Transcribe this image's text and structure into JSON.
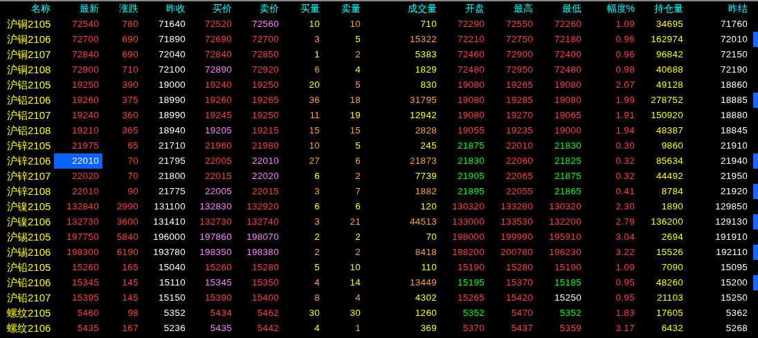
{
  "columns": [
    "名称",
    "最新",
    "涨跌",
    "昨收",
    "买价",
    "卖价",
    "买量",
    "卖量",
    "成交量",
    "开盘",
    "最高",
    "最低",
    "幅度%",
    "持仓量",
    "昨结"
  ],
  "rows": [
    {
      "name": "沪铜2105",
      "selected": false,
      "marked": false,
      "cells": [
        {
          "text": "72540",
          "color": "#ff4040"
        },
        {
          "text": "780",
          "color": "#ff4040"
        },
        {
          "text": "71640",
          "color": "#ffffff"
        },
        {
          "text": "72520",
          "color": "#ff4040"
        },
        {
          "text": "72560",
          "color": "#ff80ff"
        },
        {
          "text": "10",
          "color": "#ffff00"
        },
        {
          "text": "10",
          "color": "#ff9f40"
        },
        {
          "text": "710",
          "color": "#ffff00"
        },
        {
          "text": "72290",
          "color": "#ff4040"
        },
        {
          "text": "72550",
          "color": "#ff4040"
        },
        {
          "text": "72260",
          "color": "#ff4040"
        },
        {
          "text": "1.09",
          "color": "#ff4040"
        },
        {
          "text": "34695",
          "color": "#ffff00"
        },
        {
          "text": "71760",
          "color": "#ffffff"
        }
      ]
    },
    {
      "name": "沪铜2106",
      "selected": false,
      "marked": true,
      "cells": [
        {
          "text": "72700",
          "color": "#ff4040"
        },
        {
          "text": "690",
          "color": "#ff4040"
        },
        {
          "text": "71890",
          "color": "#ffffff"
        },
        {
          "text": "72690",
          "color": "#ff4040"
        },
        {
          "text": "72700",
          "color": "#ff4040"
        },
        {
          "text": "3",
          "color": "#ff9f40"
        },
        {
          "text": "5",
          "color": "#ffff00"
        },
        {
          "text": "15322",
          "color": "#ff9f40"
        },
        {
          "text": "72210",
          "color": "#ff4040"
        },
        {
          "text": "72750",
          "color": "#ff4040"
        },
        {
          "text": "72180",
          "color": "#ff4040"
        },
        {
          "text": "0.96",
          "color": "#ff4040"
        },
        {
          "text": "162974",
          "color": "#ffff00"
        },
        {
          "text": "72010",
          "color": "#ffffff"
        }
      ]
    },
    {
      "name": "沪铜2107",
      "selected": false,
      "marked": false,
      "cells": [
        {
          "text": "72840",
          "color": "#ff4040"
        },
        {
          "text": "690",
          "color": "#ff4040"
        },
        {
          "text": "72040",
          "color": "#ffffff"
        },
        {
          "text": "72840",
          "color": "#ff4040"
        },
        {
          "text": "72850",
          "color": "#ff4040"
        },
        {
          "text": "1",
          "color": "#ffff00"
        },
        {
          "text": "2",
          "color": "#ff9f40"
        },
        {
          "text": "5383",
          "color": "#ffff00"
        },
        {
          "text": "72460",
          "color": "#ff4040"
        },
        {
          "text": "72900",
          "color": "#ff4040"
        },
        {
          "text": "72400",
          "color": "#ff4040"
        },
        {
          "text": "0.96",
          "color": "#ff4040"
        },
        {
          "text": "96842",
          "color": "#ffff00"
        },
        {
          "text": "72150",
          "color": "#ffffff"
        }
      ]
    },
    {
      "name": "沪铜2108",
      "selected": false,
      "marked": false,
      "cells": [
        {
          "text": "72900",
          "color": "#ff4040"
        },
        {
          "text": "710",
          "color": "#ff4040"
        },
        {
          "text": "72100",
          "color": "#ffffff"
        },
        {
          "text": "72890",
          "color": "#ff80ff"
        },
        {
          "text": "72920",
          "color": "#ff4040"
        },
        {
          "text": "6",
          "color": "#ff9f40"
        },
        {
          "text": "4",
          "color": "#ffff00"
        },
        {
          "text": "1829",
          "color": "#ffff00"
        },
        {
          "text": "72480",
          "color": "#ff4040"
        },
        {
          "text": "72950",
          "color": "#ff4040"
        },
        {
          "text": "72480",
          "color": "#ff4040"
        },
        {
          "text": "0.98",
          "color": "#ff4040"
        },
        {
          "text": "40688",
          "color": "#ffff00"
        },
        {
          "text": "72190",
          "color": "#ffffff"
        }
      ]
    },
    {
      "name": "沪铝2105",
      "selected": false,
      "marked": false,
      "cells": [
        {
          "text": "19250",
          "color": "#ff4040"
        },
        {
          "text": "390",
          "color": "#ff4040"
        },
        {
          "text": "19000",
          "color": "#ffffff"
        },
        {
          "text": "19240",
          "color": "#ff4040"
        },
        {
          "text": "19250",
          "color": "#ff4040"
        },
        {
          "text": "20",
          "color": "#ffff00"
        },
        {
          "text": "5",
          "color": "#ff9f40"
        },
        {
          "text": "830",
          "color": "#ffff00"
        },
        {
          "text": "19080",
          "color": "#ff4040"
        },
        {
          "text": "19265",
          "color": "#ff4040"
        },
        {
          "text": "19080",
          "color": "#ff4040"
        },
        {
          "text": "2.07",
          "color": "#ff4040"
        },
        {
          "text": "49128",
          "color": "#ffff00"
        },
        {
          "text": "18860",
          "color": "#ffffff"
        }
      ]
    },
    {
      "name": "沪铝2106",
      "selected": false,
      "marked": true,
      "cells": [
        {
          "text": "19260",
          "color": "#ff4040"
        },
        {
          "text": "375",
          "color": "#ff4040"
        },
        {
          "text": "18990",
          "color": "#ffffff"
        },
        {
          "text": "19260",
          "color": "#ff4040"
        },
        {
          "text": "19265",
          "color": "#ff4040"
        },
        {
          "text": "36",
          "color": "#ff9f40"
        },
        {
          "text": "18",
          "color": "#ff9f40"
        },
        {
          "text": "31795",
          "color": "#ff9f40"
        },
        {
          "text": "19080",
          "color": "#ff4040"
        },
        {
          "text": "19285",
          "color": "#ff4040"
        },
        {
          "text": "19080",
          "color": "#ff4040"
        },
        {
          "text": "1.99",
          "color": "#ff4040"
        },
        {
          "text": "278752",
          "color": "#ffff00"
        },
        {
          "text": "18885",
          "color": "#ffffff"
        }
      ]
    },
    {
      "name": "沪铝2107",
      "selected": false,
      "marked": false,
      "cells": [
        {
          "text": "19240",
          "color": "#ff4040"
        },
        {
          "text": "360",
          "color": "#ff4040"
        },
        {
          "text": "18990",
          "color": "#ffffff"
        },
        {
          "text": "19245",
          "color": "#ff4040"
        },
        {
          "text": "19250",
          "color": "#ff4040"
        },
        {
          "text": "11",
          "color": "#ff9f40"
        },
        {
          "text": "19",
          "color": "#ffff00"
        },
        {
          "text": "12942",
          "color": "#ffff00"
        },
        {
          "text": "19080",
          "color": "#ff4040"
        },
        {
          "text": "19270",
          "color": "#ff4040"
        },
        {
          "text": "19065",
          "color": "#ff4040"
        },
        {
          "text": "1.91",
          "color": "#ff4040"
        },
        {
          "text": "150920",
          "color": "#ffff00"
        },
        {
          "text": "18880",
          "color": "#ffffff"
        }
      ]
    },
    {
      "name": "沪铝2108",
      "selected": false,
      "marked": false,
      "cells": [
        {
          "text": "19210",
          "color": "#ff4040"
        },
        {
          "text": "365",
          "color": "#ff4040"
        },
        {
          "text": "18940",
          "color": "#ffffff"
        },
        {
          "text": "19205",
          "color": "#ff80ff"
        },
        {
          "text": "19215",
          "color": "#ff4040"
        },
        {
          "text": "15",
          "color": "#ff9f40"
        },
        {
          "text": "15",
          "color": "#ff9f40"
        },
        {
          "text": "2828",
          "color": "#ff9f40"
        },
        {
          "text": "19055",
          "color": "#ff4040"
        },
        {
          "text": "19235",
          "color": "#ff4040"
        },
        {
          "text": "19000",
          "color": "#ff4040"
        },
        {
          "text": "1.94",
          "color": "#ff4040"
        },
        {
          "text": "48387",
          "color": "#ffff00"
        },
        {
          "text": "18845",
          "color": "#ffffff"
        }
      ]
    },
    {
      "name": "沪锌2105",
      "selected": false,
      "marked": false,
      "cells": [
        {
          "text": "21975",
          "color": "#ff4040"
        },
        {
          "text": "65",
          "color": "#ff4040"
        },
        {
          "text": "21710",
          "color": "#ffffff"
        },
        {
          "text": "21960",
          "color": "#ff4040"
        },
        {
          "text": "21980",
          "color": "#ff4040"
        },
        {
          "text": "10",
          "color": "#ff9f40"
        },
        {
          "text": "5",
          "color": "#ffff00"
        },
        {
          "text": "245",
          "color": "#ffff00"
        },
        {
          "text": "21875",
          "color": "#00ff00"
        },
        {
          "text": "22010",
          "color": "#ff4040"
        },
        {
          "text": "21830",
          "color": "#00ff00"
        },
        {
          "text": "0.30",
          "color": "#ff4040"
        },
        {
          "text": "9860",
          "color": "#ffff00"
        },
        {
          "text": "21910",
          "color": "#ffffff"
        }
      ]
    },
    {
      "name": "沪锌2106",
      "selected": true,
      "marked": true,
      "cells": [
        {
          "text": "22010",
          "color": "#ffffff"
        },
        {
          "text": "70",
          "color": "#ff4040"
        },
        {
          "text": "21795",
          "color": "#ffffff"
        },
        {
          "text": "22005",
          "color": "#ff4040"
        },
        {
          "text": "22010",
          "color": "#ff80ff"
        },
        {
          "text": "27",
          "color": "#ff9f40"
        },
        {
          "text": "6",
          "color": "#ff9f40"
        },
        {
          "text": "21873",
          "color": "#ff9f40"
        },
        {
          "text": "21830",
          "color": "#00ff00"
        },
        {
          "text": "22060",
          "color": "#ff4040"
        },
        {
          "text": "21825",
          "color": "#00ff00"
        },
        {
          "text": "0.32",
          "color": "#ff4040"
        },
        {
          "text": "85634",
          "color": "#ffff00"
        },
        {
          "text": "21940",
          "color": "#ffffff"
        }
      ]
    },
    {
      "name": "沪锌2107",
      "selected": false,
      "marked": false,
      "cells": [
        {
          "text": "22020",
          "color": "#ff4040"
        },
        {
          "text": "70",
          "color": "#ff4040"
        },
        {
          "text": "21800",
          "color": "#ffffff"
        },
        {
          "text": "22015",
          "color": "#ff4040"
        },
        {
          "text": "22020",
          "color": "#ff80ff"
        },
        {
          "text": "6",
          "color": "#ffff00"
        },
        {
          "text": "2",
          "color": "#ff9f40"
        },
        {
          "text": "7739",
          "color": "#ffff00"
        },
        {
          "text": "21905",
          "color": "#00ff00"
        },
        {
          "text": "22065",
          "color": "#ff4040"
        },
        {
          "text": "21875",
          "color": "#00ff00"
        },
        {
          "text": "0.32",
          "color": "#ff4040"
        },
        {
          "text": "44492",
          "color": "#ffff00"
        },
        {
          "text": "21950",
          "color": "#ffffff"
        }
      ]
    },
    {
      "name": "沪锌2108",
      "selected": false,
      "marked": true,
      "cells": [
        {
          "text": "22010",
          "color": "#ff4040"
        },
        {
          "text": "90",
          "color": "#ff4040"
        },
        {
          "text": "21775",
          "color": "#ffffff"
        },
        {
          "text": "22005",
          "color": "#ff80ff"
        },
        {
          "text": "22015",
          "color": "#ff4040"
        },
        {
          "text": "3",
          "color": "#ff9f40"
        },
        {
          "text": "7",
          "color": "#ff9f40"
        },
        {
          "text": "1882",
          "color": "#ff9f40"
        },
        {
          "text": "21895",
          "color": "#00ff00"
        },
        {
          "text": "22055",
          "color": "#ff4040"
        },
        {
          "text": "21865",
          "color": "#00ff00"
        },
        {
          "text": "0.41",
          "color": "#ff4040"
        },
        {
          "text": "8784",
          "color": "#ffff00"
        },
        {
          "text": "21920",
          "color": "#ffffff"
        }
      ]
    },
    {
      "name": "沪镍2105",
      "selected": false,
      "marked": false,
      "cells": [
        {
          "text": "132840",
          "color": "#ff4040"
        },
        {
          "text": "2990",
          "color": "#ff4040"
        },
        {
          "text": "131100",
          "color": "#ffffff"
        },
        {
          "text": "132830",
          "color": "#ff80ff"
        },
        {
          "text": "132920",
          "color": "#ff4040"
        },
        {
          "text": "6",
          "color": "#ffff00"
        },
        {
          "text": "6",
          "color": "#ffff00"
        },
        {
          "text": "120",
          "color": "#ffff00"
        },
        {
          "text": "130320",
          "color": "#ff4040"
        },
        {
          "text": "133280",
          "color": "#ff4040"
        },
        {
          "text": "130320",
          "color": "#ff4040"
        },
        {
          "text": "2.30",
          "color": "#ff4040"
        },
        {
          "text": "1890",
          "color": "#ffff00"
        },
        {
          "text": "129850",
          "color": "#ffffff"
        }
      ]
    },
    {
      "name": "沪镍2106",
      "selected": false,
      "marked": true,
      "cells": [
        {
          "text": "132730",
          "color": "#ff4040"
        },
        {
          "text": "3600",
          "color": "#ff4040"
        },
        {
          "text": "131410",
          "color": "#ffffff"
        },
        {
          "text": "132730",
          "color": "#ff4040"
        },
        {
          "text": "132740",
          "color": "#ff4040"
        },
        {
          "text": "3",
          "color": "#ff9f40"
        },
        {
          "text": "21",
          "color": "#ff9f40"
        },
        {
          "text": "44513",
          "color": "#ff9f40"
        },
        {
          "text": "133000",
          "color": "#ff4040"
        },
        {
          "text": "133530",
          "color": "#ff4040"
        },
        {
          "text": "132200",
          "color": "#ff4040"
        },
        {
          "text": "2.79",
          "color": "#ff4040"
        },
        {
          "text": "136200",
          "color": "#ffff00"
        },
        {
          "text": "129130",
          "color": "#ffffff"
        }
      ]
    },
    {
      "name": "沪锡2105",
      "selected": false,
      "marked": false,
      "cells": [
        {
          "text": "197750",
          "color": "#ff4040"
        },
        {
          "text": "5840",
          "color": "#ff4040"
        },
        {
          "text": "196000",
          "color": "#ffffff"
        },
        {
          "text": "197860",
          "color": "#ff80ff"
        },
        {
          "text": "198070",
          "color": "#ff80ff"
        },
        {
          "text": "2",
          "color": "#ffff00"
        },
        {
          "text": "2",
          "color": "#ffff00"
        },
        {
          "text": "70",
          "color": "#ffff00"
        },
        {
          "text": "198000",
          "color": "#ff4040"
        },
        {
          "text": "199990",
          "color": "#ff4040"
        },
        {
          "text": "195910",
          "color": "#ff4040"
        },
        {
          "text": "3.04",
          "color": "#ff4040"
        },
        {
          "text": "2694",
          "color": "#ffff00"
        },
        {
          "text": "191910",
          "color": "#ffffff"
        }
      ]
    },
    {
      "name": "沪锡2106",
      "selected": false,
      "marked": true,
      "cells": [
        {
          "text": "198300",
          "color": "#ff4040"
        },
        {
          "text": "6190",
          "color": "#ff4040"
        },
        {
          "text": "193780",
          "color": "#ffffff"
        },
        {
          "text": "198350",
          "color": "#ff80ff"
        },
        {
          "text": "198380",
          "color": "#ff80ff"
        },
        {
          "text": "2",
          "color": "#ff9f40"
        },
        {
          "text": "2",
          "color": "#ff9f40"
        },
        {
          "text": "8418",
          "color": "#ff9f40"
        },
        {
          "text": "198200",
          "color": "#ff4040"
        },
        {
          "text": "200780",
          "color": "#ff4040"
        },
        {
          "text": "196230",
          "color": "#ff4040"
        },
        {
          "text": "3.22",
          "color": "#ff4040"
        },
        {
          "text": "15526",
          "color": "#ffff00"
        },
        {
          "text": "192110",
          "color": "#ffffff"
        }
      ]
    },
    {
      "name": "沪铅2105",
      "selected": false,
      "marked": false,
      "cells": [
        {
          "text": "15260",
          "color": "#ff4040"
        },
        {
          "text": "165",
          "color": "#ff4040"
        },
        {
          "text": "15040",
          "color": "#ffffff"
        },
        {
          "text": "15260",
          "color": "#ff4040"
        },
        {
          "text": "15280",
          "color": "#ff4040"
        },
        {
          "text": "5",
          "color": "#ffff00"
        },
        {
          "text": "10",
          "color": "#ffff00"
        },
        {
          "text": "110",
          "color": "#ffff00"
        },
        {
          "text": "15190",
          "color": "#ff4040"
        },
        {
          "text": "15280",
          "color": "#ff4040"
        },
        {
          "text": "15190",
          "color": "#ff4040"
        },
        {
          "text": "1.09",
          "color": "#ff4040"
        },
        {
          "text": "7090",
          "color": "#ffff00"
        },
        {
          "text": "15095",
          "color": "#ffffff"
        }
      ]
    },
    {
      "name": "沪铅2106",
      "selected": false,
      "marked": true,
      "cells": [
        {
          "text": "15345",
          "color": "#ff4040"
        },
        {
          "text": "145",
          "color": "#ff4040"
        },
        {
          "text": "15110",
          "color": "#ffffff"
        },
        {
          "text": "15345",
          "color": "#ff80ff"
        },
        {
          "text": "15350",
          "color": "#ff4040"
        },
        {
          "text": "4",
          "color": "#ff9f40"
        },
        {
          "text": "14",
          "color": "#ffff00"
        },
        {
          "text": "13449",
          "color": "#ff9f40"
        },
        {
          "text": "15195",
          "color": "#00ff00"
        },
        {
          "text": "15370",
          "color": "#ff4040"
        },
        {
          "text": "15185",
          "color": "#00ff00"
        },
        {
          "text": "0.95",
          "color": "#ff4040"
        },
        {
          "text": "48260",
          "color": "#ffff00"
        },
        {
          "text": "15200",
          "color": "#ffffff"
        }
      ]
    },
    {
      "name": "沪铅2107",
      "selected": false,
      "marked": false,
      "cells": [
        {
          "text": "15395",
          "color": "#ff4040"
        },
        {
          "text": "145",
          "color": "#ff4040"
        },
        {
          "text": "15150",
          "color": "#ffffff"
        },
        {
          "text": "15390",
          "color": "#ff4040"
        },
        {
          "text": "15400",
          "color": "#ff4040"
        },
        {
          "text": "8",
          "color": "#ff9f40"
        },
        {
          "text": "4",
          "color": "#ff9f40"
        },
        {
          "text": "4302",
          "color": "#ffff00"
        },
        {
          "text": "15265",
          "color": "#ff4040"
        },
        {
          "text": "15420",
          "color": "#ff4040"
        },
        {
          "text": "15250",
          "color": "#ffffff"
        },
        {
          "text": "0.95",
          "color": "#ff4040"
        },
        {
          "text": "21103",
          "color": "#ffff00"
        },
        {
          "text": "15250",
          "color": "#ffffff"
        }
      ]
    },
    {
      "name": "螺纹2105",
      "selected": false,
      "marked": false,
      "cells": [
        {
          "text": "5460",
          "color": "#ff4040"
        },
        {
          "text": "98",
          "color": "#ff4040"
        },
        {
          "text": "5352",
          "color": "#ffffff"
        },
        {
          "text": "5434",
          "color": "#ff4040"
        },
        {
          "text": "5462",
          "color": "#ff4040"
        },
        {
          "text": "30",
          "color": "#ffff00"
        },
        {
          "text": "30",
          "color": "#ffff00"
        },
        {
          "text": "1260",
          "color": "#ffff00"
        },
        {
          "text": "5352",
          "color": "#00ff00"
        },
        {
          "text": "5470",
          "color": "#ff4040"
        },
        {
          "text": "5352",
          "color": "#00ff00"
        },
        {
          "text": "1.83",
          "color": "#ff4040"
        },
        {
          "text": "17605",
          "color": "#ffff00"
        },
        {
          "text": "5362",
          "color": "#ffffff"
        }
      ]
    },
    {
      "name": "螺纹2106",
      "selected": false,
      "marked": false,
      "cells": [
        {
          "text": "5435",
          "color": "#ff4040"
        },
        {
          "text": "167",
          "color": "#ff4040"
        },
        {
          "text": "5236",
          "color": "#ffffff"
        },
        {
          "text": "5435",
          "color": "#ff80ff"
        },
        {
          "text": "5442",
          "color": "#ff4040"
        },
        {
          "text": "4",
          "color": "#ffff00"
        },
        {
          "text": "1",
          "color": "#ff9f40"
        },
        {
          "text": "369",
          "color": "#ffff00"
        },
        {
          "text": "5370",
          "color": "#ff4040"
        },
        {
          "text": "5437",
          "color": "#ff4040"
        },
        {
          "text": "5359",
          "color": "#ff4040"
        },
        {
          "text": "3.17",
          "color": "#ff4040"
        },
        {
          "text": "6432",
          "color": "#ffff00"
        },
        {
          "text": "5268",
          "color": "#ffffff"
        }
      ]
    }
  ]
}
